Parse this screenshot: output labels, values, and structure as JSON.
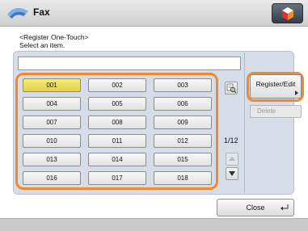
{
  "titlebar": {
    "title": "Fax",
    "top_button_icon": "counter-check-icon"
  },
  "instruction": {
    "line1": "<Register One-Touch>",
    "line2": "Select an item."
  },
  "text_field": {
    "value": ""
  },
  "grid": {
    "cells": [
      "001",
      "002",
      "003",
      "004",
      "005",
      "006",
      "007",
      "008",
      "009",
      "010",
      "011",
      "012",
      "013",
      "014",
      "015",
      "016",
      "017",
      "018"
    ],
    "selected": "001"
  },
  "pagination": {
    "page": "1/12"
  },
  "buttons": {
    "register_edit": "Register/Edit",
    "delete": "Delete",
    "close": "Close"
  },
  "colors": {
    "highlight": "#ef8b2c",
    "selected_cell": "#f0e56a",
    "panel": "#d6dde8"
  }
}
